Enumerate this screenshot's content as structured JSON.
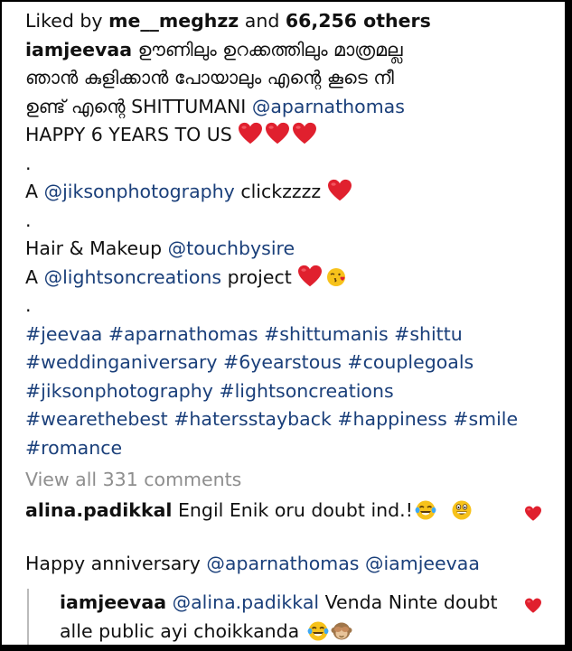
{
  "post": {
    "liked_prefix": "Liked by",
    "liked_user": "me__meghzz",
    "liked_mid": "and",
    "liked_others": "66,256 others",
    "author": "iamjeevaa",
    "caption_line1": "ഊണിലും ഉറക്കത്തിലും മാത്രമല്ല",
    "caption_line2": "ഞാൻ കുളിക്കാൻ പോയാലും എന്റെ കൂടെ നീ",
    "caption_line3_text": "ഉണ്ട് എന്റെ SHITTUMANI",
    "caption_line3_mention": "@aparnathomas",
    "caption_line4": "HAPPY 6 YEARS TO US",
    "dot": ".",
    "photo_prefix": "A",
    "photo_mention": "@jiksonphotography",
    "photo_suffix": "clickzzzz",
    "hair_text": "Hair & Makeup",
    "hair_mention": "@touchbysire",
    "project_prefix": "A",
    "project_mention": "@lightsoncreations",
    "project_suffix": "project",
    "hashtags_line1": "#jeevaa #aparnathomas #shittumanis #shittu",
    "hashtags_line2": "#weddinganiversary #6yearstous #couplegoals",
    "hashtags_line3": "#jiksonphotography #lightsoncreations",
    "hashtags_line4": "#wearethebest #hatersstayback #happiness #smile",
    "hashtags_line5": "#romance",
    "view_all": "View all 331 comments"
  },
  "comments": [
    {
      "user": "alina.padikkal",
      "text": "Engil Enik oru doubt ind.!"
    },
    {
      "text_prefix": "Happy anniversary",
      "mention1": "@aparnathomas",
      "mention2": "@iamjeevaa"
    }
  ],
  "reply": {
    "user": "iamjeevaa",
    "mention": "@alina.padikkal",
    "text_line1": "Venda Ninte doubt",
    "text_line2": "alle public ayi choikkanda"
  },
  "colors": {
    "mention": "#1a3f7a",
    "heart": "#e0202e",
    "muted": "#8e8e8e"
  },
  "icons": [
    "heart-emoji",
    "face-with-tears-of-joy-emoji",
    "grinning-face-emoji",
    "face-blowing-kiss-emoji",
    "see-no-evil-monkey-emoji",
    "like-heart-icon"
  ]
}
